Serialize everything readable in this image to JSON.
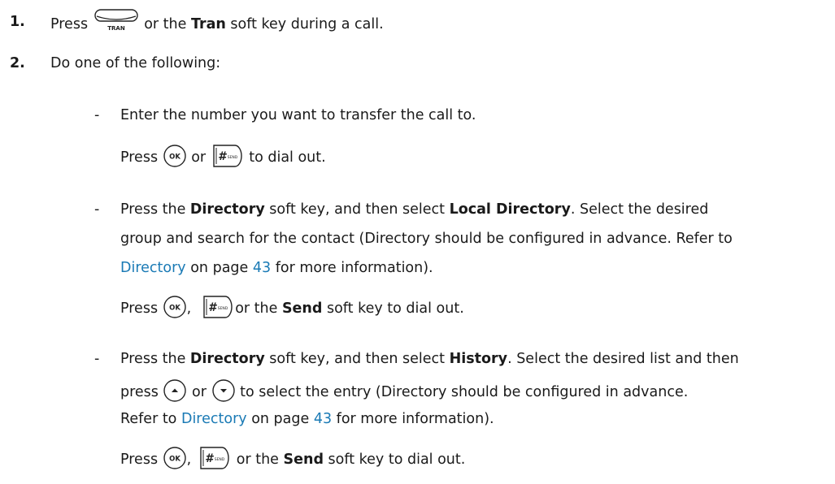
{
  "steps": [
    {
      "number": "1.",
      "before": "Press ",
      "key_label": "TRAN",
      "middle": " or the ",
      "bold": "Tran",
      "after": " soft key during a call."
    },
    {
      "number": "2.",
      "text": "Do one of the following:"
    }
  ],
  "options": [
    {
      "bullet": "-",
      "line1": "Enter the number you want to transfer the call to.",
      "press": "Press ",
      "or": " or ",
      "tail": " to dial out."
    },
    {
      "bullet": "-",
      "l1_a": "Press the ",
      "l1_b": "Directory",
      "l1_c": " soft key, and then select ",
      "l1_d": "Local Directory",
      "l1_e": ". Select the desired",
      "l2": "group and search for the contact (Directory should be configured in advance. Refer to",
      "l3_link": "Directory",
      "l3_b": " on page ",
      "l3_page": "43",
      "l3_c": " for more information).",
      "l4_press": "Press ",
      "l4_comma": ",",
      "l4_or": "or the ",
      "l4_bold": "Send",
      "l4_tail": " soft key to dial out."
    },
    {
      "bullet": "-",
      "l1_a": "Press the ",
      "l1_b": "Directory",
      "l1_c": " soft key, and then select ",
      "l1_d": "History",
      "l1_e": ". Select the desired list and then",
      "l2_press": "press ",
      "l2_or": " or ",
      "l2_tail": " to select the entry (Directory should be configured in advance.",
      "l3_a": "Refer to ",
      "l3_link": "Directory",
      "l3_b": " on page ",
      "l3_page": "43",
      "l3_c": " for more information).",
      "l4_press": "Press ",
      "l4_comma": ",",
      "l4_or": " or the ",
      "l4_bold": "Send",
      "l4_tail": " soft key to dial out."
    }
  ],
  "keys": {
    "ok": "OK",
    "send_hash": "#",
    "send_small": "SEND"
  },
  "colors": {
    "link": "#1a7ab5",
    "text": "#1a1a1a"
  }
}
